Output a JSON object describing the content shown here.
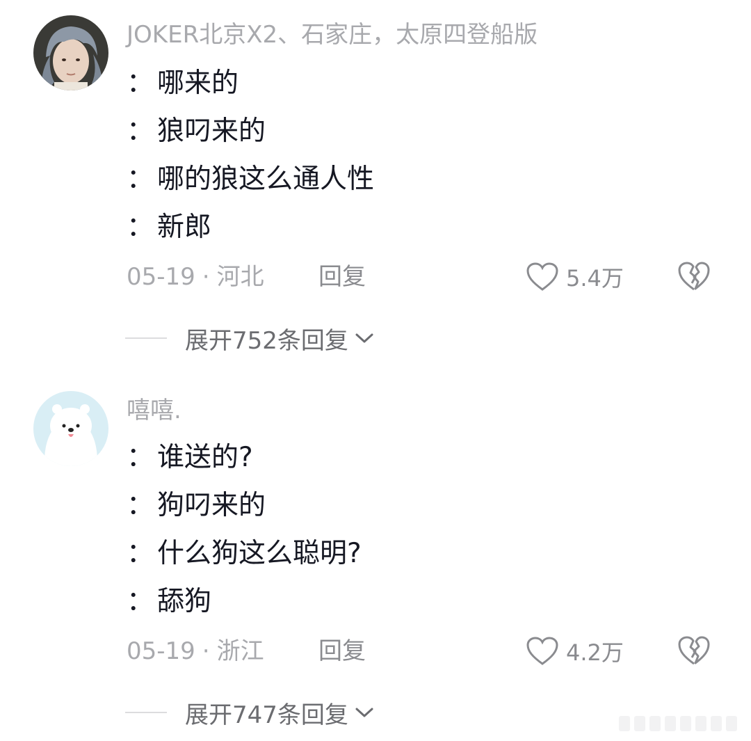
{
  "comments": [
    {
      "username": "JOKER北京X2、石家庄，太原四登船版",
      "lines": [
        "哪来的",
        "狼叼来的",
        "哪的狼这么通人性",
        "新郎"
      ],
      "date": "05-19",
      "separator": "·",
      "location": "河北",
      "reply_label": "回复",
      "like_count": "5.4万",
      "expand_label": "展开752条回复"
    },
    {
      "username": "嘻嘻.",
      "lines": [
        "谁送的?",
        "狗叼来的",
        "什么狗这么聪明?",
        "舔狗"
      ],
      "date": "05-19",
      "separator": "·",
      "location": "浙江",
      "reply_label": "回复",
      "like_count": "4.2万",
      "expand_label": "展开747条回复"
    }
  ],
  "line_prefix": "：",
  "icons": {
    "like": "heart-outline-icon",
    "dislike": "broken-heart-icon",
    "expand": "chevron-down-icon"
  },
  "colors": {
    "text_primary": "#161823",
    "text_secondary": "#a8a9ad",
    "avatar_bear_bg": "#d9eef5"
  }
}
